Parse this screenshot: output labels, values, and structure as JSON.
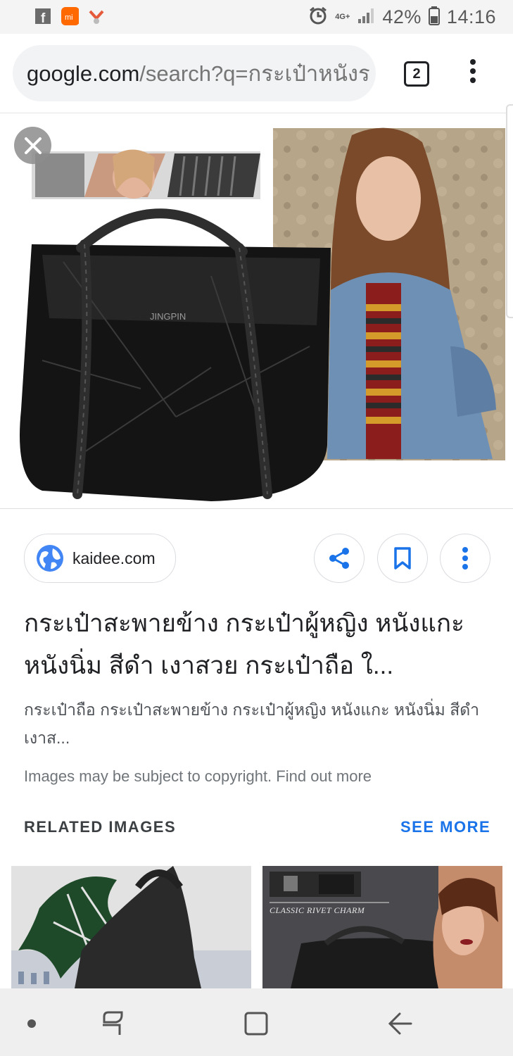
{
  "status_bar": {
    "network": "4G+",
    "battery": "42%",
    "time": "14:16",
    "icons": [
      "facebook-icon",
      "mi-app-icon",
      "notification-app-icon",
      "alarm-icon",
      "signal-icon",
      "battery-icon"
    ]
  },
  "browser": {
    "url_host": "google.com",
    "url_path": "/search?q=กระเป๋าหนังร",
    "tab_count": "2",
    "menu_icon": "more-vert-icon"
  },
  "viewer": {
    "image_alt": "Black leather tote bag with braided straps and model in denim jacket",
    "brand_on_bag": "JINGPIN",
    "close_icon": "close-icon"
  },
  "source": {
    "site": "kaidee.com",
    "globe_icon": "globe-icon",
    "actions": [
      "share-icon",
      "bookmark-icon",
      "more-vert-icon"
    ]
  },
  "result": {
    "title": "กระเป๋าสะพายข้าง กระเป๋าผู้หญิง หนังแกะ หนังนิ่ม สีดำ เงาสวย กระเป๋าถือ ใ...",
    "description": "กระเป๋าถือ กระเป๋าสะพายข้าง กระเป๋าผู้หญิง หนังแกะ หนังนิ่ม สีดำ เงาส...",
    "copyright": "Images may be subject to copyright. Find out more"
  },
  "related": {
    "heading": "RELATED IMAGES",
    "see_more": "SEE MORE",
    "thumb2_caption": "CLASSIC RIVET CHARM"
  },
  "colors": {
    "accent": "#1a73e8",
    "text": "#202124",
    "secondary_text": "#70757a"
  },
  "nav_bar": {
    "buttons": [
      "dot-icon",
      "recents-icon",
      "home-icon",
      "back-icon"
    ]
  }
}
